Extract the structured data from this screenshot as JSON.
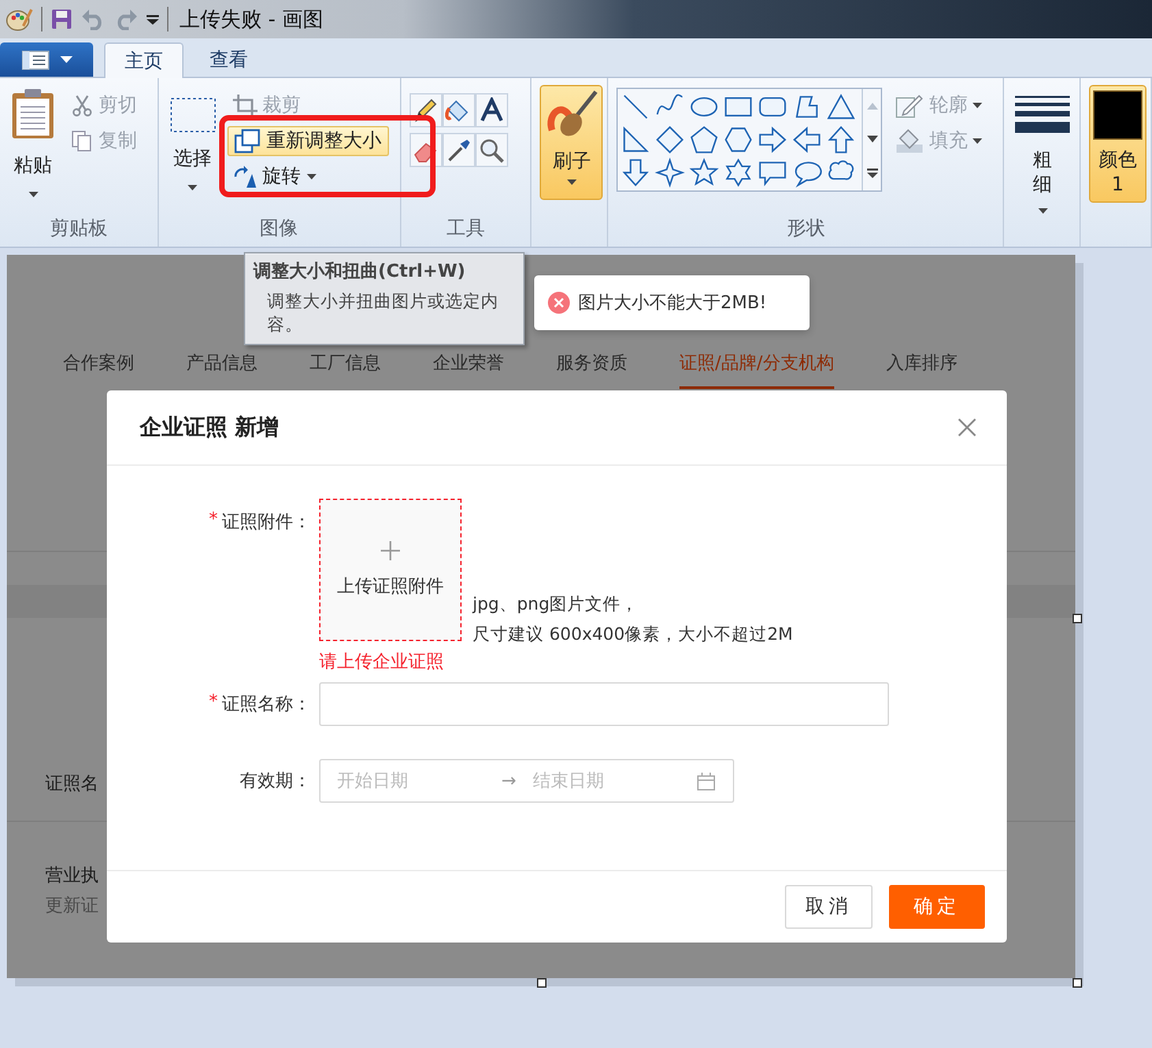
{
  "title_bar": {
    "title": "上传失败 - 画图"
  },
  "ribbon_tabs": [
    {
      "label": "主页",
      "selected": true
    },
    {
      "label": "查看",
      "selected": false
    }
  ],
  "ribbon": {
    "clipboard": {
      "group_label": "剪贴板",
      "paste": "粘贴",
      "actions": [
        {
          "label": "剪切",
          "disabled": true
        },
        {
          "label": "复制",
          "disabled": true
        }
      ]
    },
    "image": {
      "group_label": "图像",
      "select": "选择",
      "actions": [
        {
          "label": "裁剪",
          "disabled": true,
          "highlighted": false,
          "caret": false
        },
        {
          "label": "重新调整大小",
          "disabled": false,
          "highlighted": true,
          "caret": false
        },
        {
          "label": "旋转",
          "disabled": false,
          "highlighted": false,
          "caret": true
        }
      ]
    },
    "tools": {
      "group_label": "工具"
    },
    "brushes": {
      "label": "刷子",
      "selected": true
    },
    "shapes": {
      "group_label": "形状",
      "options": [
        {
          "label": "轮廓",
          "disabled": true
        },
        {
          "label": "填充",
          "disabled": true
        }
      ]
    },
    "size": {
      "label": "粗细"
    },
    "color1": {
      "label": "颜色 1",
      "selected": true,
      "color": "#000000"
    }
  },
  "tooltip": {
    "title": "调整大小和扭曲(Ctrl+W)",
    "text": "调整大小并扭曲图片或选定内容。"
  },
  "toast": {
    "text": "图片大小不能大于2MB!"
  },
  "web_page": {
    "nav_tabs": [
      {
        "label": "合作案例",
        "selected": false
      },
      {
        "label": "产品信息",
        "selected": false
      },
      {
        "label": "工厂信息",
        "selected": false
      },
      {
        "label": "企业荣誉",
        "selected": false
      },
      {
        "label": "服务资质",
        "selected": false
      },
      {
        "label": "证照/品牌/分支机构",
        "selected": true
      },
      {
        "label": "入库排序",
        "selected": false
      }
    ],
    "background_rows": [
      {
        "title": "证照名"
      },
      {
        "title": "营业执",
        "subtitle": "更新证"
      }
    ]
  },
  "modal": {
    "title": "企业证照 新增",
    "fields": [
      {
        "kind": "upload",
        "required_mark": "*",
        "label": "证照附件：",
        "button": "上传证照附件",
        "hint_lines": [
          "jpg、png图片文件，",
          "尺寸建议 600x400像素，大小不超过2M"
        ],
        "error": "请上传企业证照"
      },
      {
        "kind": "text",
        "required_mark": "*",
        "label": "证照名称："
      },
      {
        "kind": "daterange",
        "label": "有效期：",
        "start_placeholder": "开始日期",
        "separator": "→",
        "end_placeholder": "结束日期"
      }
    ],
    "buttons": [
      {
        "label": "取消",
        "kind": "secondary"
      },
      {
        "label": "确定",
        "kind": "primary"
      }
    ]
  }
}
